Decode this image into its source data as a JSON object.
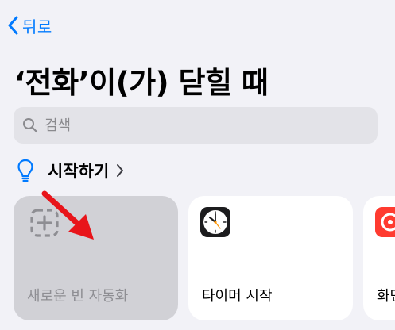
{
  "nav": {
    "back_label": "뒤로"
  },
  "header": {
    "title": "‘전화’이(가) 닫힐 때"
  },
  "search": {
    "placeholder": "검색"
  },
  "getting_started": {
    "label": "시작하기"
  },
  "cards": [
    {
      "label": "새로운 빈 자동화",
      "icon": "dashed-plus-square-icon"
    },
    {
      "label": "타이머 시작",
      "icon": "clock-icon"
    },
    {
      "label": "화면",
      "icon": "red-app-icon"
    }
  ],
  "colors": {
    "accent": "#007aff",
    "background": "#f2f2f7",
    "card": "#ffffff",
    "card_selected": "#d1d1d6",
    "annotation_arrow": "#e8141a"
  }
}
